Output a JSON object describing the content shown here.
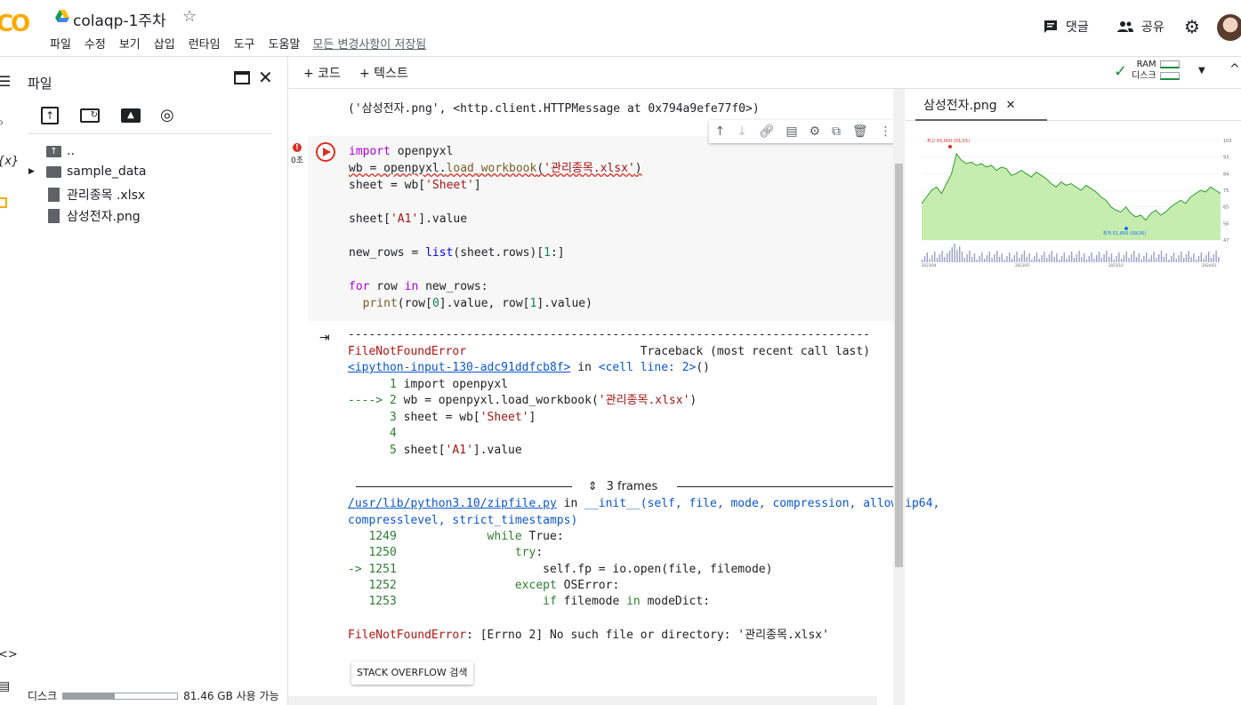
{
  "app": {
    "logo": "CO",
    "title": "colaqp-1주차"
  },
  "menu": [
    "파일",
    "수정",
    "보기",
    "삽입",
    "런타임",
    "도구",
    "도움말"
  ],
  "saved_status": "모든 변경사항이 저장됨",
  "header": {
    "comment_label": "댓글",
    "share_label": "공유"
  },
  "toolbar": {
    "add_code": "+ 코드",
    "add_text": "+ 텍스트",
    "ram_label": "RAM",
    "disk_label": "디스크"
  },
  "file_panel": {
    "title": "파일",
    "items": [
      {
        "name": "..",
        "icon": "folder-up-icon"
      },
      {
        "name": "sample_data",
        "icon": "folder-icon"
      },
      {
        "name": "관리종목 .xlsx",
        "icon": "file-icon"
      },
      {
        "name": "삼성전자.png",
        "icon": "file-icon"
      }
    ],
    "disk_label": "디스크",
    "disk_free": "81.46 GB 사용 가능",
    "disk_used_fraction": 0.45
  },
  "prev_output": "('삼성전자.png', <http.client.HTTPMessage at 0x794a9efe77f0>)",
  "cell": {
    "exec_label": "0초",
    "code_lines": [
      "import openpyxl",
      "wb = openpyxl.load_workbook('관리종목.xlsx')",
      "sheet = wb['Sheet']",
      "",
      "sheet['A1'].value",
      "",
      "new_rows = list(sheet.rows)[1:]",
      "",
      "for row in new_rows:",
      "  print(row[0].value, row[1].value)"
    ]
  },
  "traceback": {
    "divider": "---------------------------------------------------------------------------",
    "error_name": "FileNotFoundError",
    "traceback_header": "Traceback (most recent call last)",
    "input_link": "<ipython-input-130-adc91ddfcb8f>",
    "in_word": "in",
    "cell_line": "<cell line: 2>",
    "cell_line_suffix": "()",
    "lines": [
      "      1 import openpyxl",
      "----> 2 wb = openpyxl.load_workbook('관리종목.xlsx')",
      "      3 sheet = wb['Sheet']",
      "      4 ",
      "      5 sheet['A1'].value"
    ],
    "frames_label": "3 frames",
    "file_link": "/usr/lib/python3.10/zipfile.py",
    "func_sig": "__init__(self, file, mode, compression, allowZip64,",
    "func_sig2": "compresslevel, strict_timestamps)",
    "lines2": [
      "   1249             while True:",
      "   1250                 try:",
      "-> 1251                     self.fp = io.open(file, filemode)",
      "   1252                 except OSError:",
      "   1253                     if filemode in modeDict:"
    ],
    "final_error": "FileNotFoundError: [Errno 2] No such file or directory: '관리종목.xlsx'",
    "so_button": "STACK OVERFLOW 검색"
  },
  "viewer": {
    "tab_label": "삼성전자.png",
    "chart_labels": {
      "high": "최고 93,000 (01/15)",
      "low": "최저 51,800 (09/26)"
    },
    "y_ticks": [
      "103",
      "93",
      "84",
      "75",
      "65",
      "56",
      "47"
    ],
    "x_ticks": [
      "2023/04",
      "2023/07",
      "2023/10",
      "2024/01"
    ]
  },
  "chart_data": {
    "type": "area",
    "values": [
      62,
      66,
      70,
      72,
      68,
      74,
      80,
      92,
      88,
      86,
      87,
      85,
      86,
      84,
      85,
      82,
      84,
      83,
      79,
      80,
      82,
      80,
      78,
      81,
      79,
      77,
      74,
      72,
      75,
      73,
      74,
      72,
      70,
      73,
      71,
      69,
      66,
      64,
      60,
      58,
      57,
      60,
      56,
      54,
      55,
      52,
      56,
      58,
      55,
      57,
      60,
      62,
      64,
      62,
      66,
      68,
      70,
      69,
      72,
      70,
      68
    ],
    "high": 93000,
    "low": 51800
  },
  "colors": {
    "accent": "#f9ab00",
    "error": "#d93025",
    "chart_line": "#2e9e2e",
    "chart_fill": "#c7ecb0"
  }
}
